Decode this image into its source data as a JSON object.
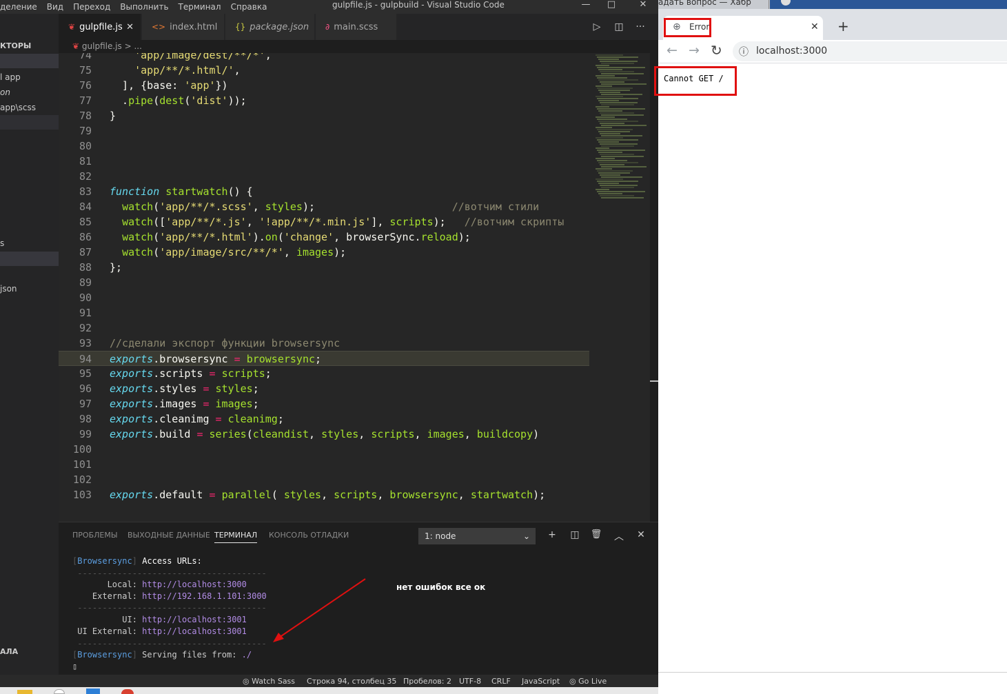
{
  "window": {
    "menu": [
      "деление",
      "Вид",
      "Переход",
      "Выполнить",
      "Терминал",
      "Справка"
    ],
    "title": "gulpfile.js - gulpbuild - Visual Studio Code",
    "controls": {
      "minimize": "—",
      "maximize": "□",
      "close": "✕"
    }
  },
  "tabs": [
    {
      "label": "gulpfile.js",
      "icon": "gulp-icon",
      "glyph": "❦",
      "color": "#e04444",
      "active": true,
      "close": "✕"
    },
    {
      "label": "index.html",
      "icon": "html-icon",
      "glyph": "<>",
      "color": "#e37933",
      "active": false
    },
    {
      "label": "package.json",
      "icon": "json-icon",
      "glyph": "{}",
      "color": "#cbcb41",
      "active": false
    },
    {
      "label": "main.scss",
      "icon": "sass-icon",
      "glyph": "∂",
      "color": "#f55385",
      "active": false
    }
  ],
  "editor_actions": {
    "run": "▷",
    "split": "◫",
    "more": "···"
  },
  "breadcrumb": {
    "file": "gulpfile.js",
    "sep": ">",
    "rest": "..."
  },
  "sidebar": {
    "heading": "КТОРЫ",
    "items": [
      "l app",
      "on",
      "app\\scss",
      "s",
      "json"
    ],
    "bottom": "АЛА"
  },
  "code": [
    {
      "n": "74",
      "html": "    <span class=\"s\">'app/image/dest/**/*'</span>,"
    },
    {
      "n": "75",
      "html": "    <span class=\"s\">'app/**/*.html/'</span>,"
    },
    {
      "n": "76",
      "html": "  ], {base: <span class=\"s\">'app'</span>})"
    },
    {
      "n": "77",
      "html": "  .<span class=\"f\">pipe</span>(<span class=\"f\">dest</span>(<span class=\"s\">'dist'</span>));"
    },
    {
      "n": "78",
      "html": "}"
    },
    {
      "n": "79",
      "html": ""
    },
    {
      "n": "80",
      "html": ""
    },
    {
      "n": "81",
      "html": ""
    },
    {
      "n": "82",
      "html": ""
    },
    {
      "n": "83",
      "html": "<span class=\"k\">function</span> <span class=\"f\">startwatch</span>() {"
    },
    {
      "n": "84",
      "html": "  <span class=\"f\">watch</span>(<span class=\"s\">'app/**/*.scss'</span>, <span class=\"f\">styles</span>);                      <span class=\"c\">//вотчим стили</span>"
    },
    {
      "n": "85",
      "html": "  <span class=\"f\">watch</span>([<span class=\"s\">'app/**/*.js'</span>, <span class=\"s\">'!app/**/*.min.js'</span>], <span class=\"f\">scripts</span>);   <span class=\"c\">//вотчим скрипты</span>"
    },
    {
      "n": "86",
      "html": "  <span class=\"f\">watch</span>(<span class=\"s\">'app/**/*.html'</span>).<span class=\"f\">on</span>(<span class=\"s\">'change'</span>, browserSync.<span class=\"f\">reload</span>);"
    },
    {
      "n": "87",
      "html": "  <span class=\"f\">watch</span>(<span class=\"s\">'app/image/src/**/*'</span>, <span class=\"f\">images</span>);"
    },
    {
      "n": "88",
      "html": "};"
    },
    {
      "n": "89",
      "html": ""
    },
    {
      "n": "90",
      "html": ""
    },
    {
      "n": "91",
      "html": ""
    },
    {
      "n": "92",
      "html": ""
    },
    {
      "n": "93",
      "html": "<span class=\"c\">//сделали экспорт функции browsersync</span>"
    },
    {
      "n": "94",
      "html": "<span class=\"k\">exports</span>.browsersync <span class=\"o\">=</span> <span class=\"f\">browsersync</span>;",
      "hl": true
    },
    {
      "n": "95",
      "html": "<span class=\"k\">exports</span>.scripts <span class=\"o\">=</span> <span class=\"f\">scripts</span>;"
    },
    {
      "n": "96",
      "html": "<span class=\"k\">exports</span>.styles <span class=\"o\">=</span> <span class=\"f\">styles</span>;"
    },
    {
      "n": "97",
      "html": "<span class=\"k\">exports</span>.images <span class=\"o\">=</span> <span class=\"f\">images</span>;"
    },
    {
      "n": "98",
      "html": "<span class=\"k\">exports</span>.cleanimg <span class=\"o\">=</span> <span class=\"f\">cleanimg</span>;"
    },
    {
      "n": "99",
      "html": "<span class=\"k\">exports</span>.build <span class=\"o\">=</span> <span class=\"f\">series</span>(<span class=\"f\">cleandist</span>, <span class=\"f\">styles</span>, <span class=\"f\">scripts</span>, <span class=\"f\">images</span>, <span class=\"f\">buildcopy</span>)"
    },
    {
      "n": "100",
      "html": ""
    },
    {
      "n": "101",
      "html": ""
    },
    {
      "n": "102",
      "html": ""
    },
    {
      "n": "103",
      "html": "<span class=\"k\">exports</span>.default <span class=\"o\">=</span> <span class=\"f\">parallel</span>( <span class=\"f\">styles</span>, <span class=\"f\">scripts</span>, <span class=\"f\">browsersync</span>, <span class=\"f\">startwatch</span>);"
    }
  ],
  "panel": {
    "tabs": [
      "ПРОБЛЕМЫ",
      "ВЫХОДНЫЕ ДАННЫЕ",
      "ТЕРМИНАЛ",
      "КОНСОЛЬ ОТЛАДКИ"
    ],
    "active_tab": 2,
    "terminal_select": "1: node",
    "icons": {
      "add": "+",
      "split": "◫",
      "trash": "🗑",
      "up": "︿",
      "close": "✕"
    }
  },
  "terminal": [
    "<span class=\"td\">[</span><span class=\"tb\">Browsersync</span><span class=\"td\">]</span> <span class=\"tw\">Access URLs:</span>",
    "<span class=\"td\"> --------------------------------------</span>",
    "       Local: <span class=\"tu\">http://localhost:3000</span>",
    "    External: <span class=\"tu\">http://192.168.1.101:3000</span>",
    "<span class=\"td\"> --------------------------------------</span>",
    "          UI: <span class=\"tu\">http://localhost:3001</span>",
    " UI External: <span class=\"tu\">http://localhost:3001</span>",
    "<span class=\"td\"> --------------------------------------</span>",
    "<span class=\"td\">[</span><span class=\"tb\">Browsersync</span><span class=\"td\">]</span> Serving files from: <span class=\"tu\">./</span>",
    "▯"
  ],
  "annotation": "нет ошибок все ок",
  "status": {
    "watch_sass": "◎ Watch Sass",
    "position": "Строка 94, столбец 35",
    "spaces": "Пробелов: 2",
    "encoding": "UTF-8",
    "eol": "CRLF",
    "language": "JavaScript",
    "golive": "◎ Go Live"
  },
  "browser": {
    "top_tab": "адать вопрос — Хабр",
    "tab_title": "Error",
    "tab_close": "✕",
    "new_tab": "+",
    "back": "←",
    "forward": "→",
    "reload": "↻",
    "info": "ⓘ",
    "url": "localhost:3000",
    "body": "Cannot GET /"
  }
}
